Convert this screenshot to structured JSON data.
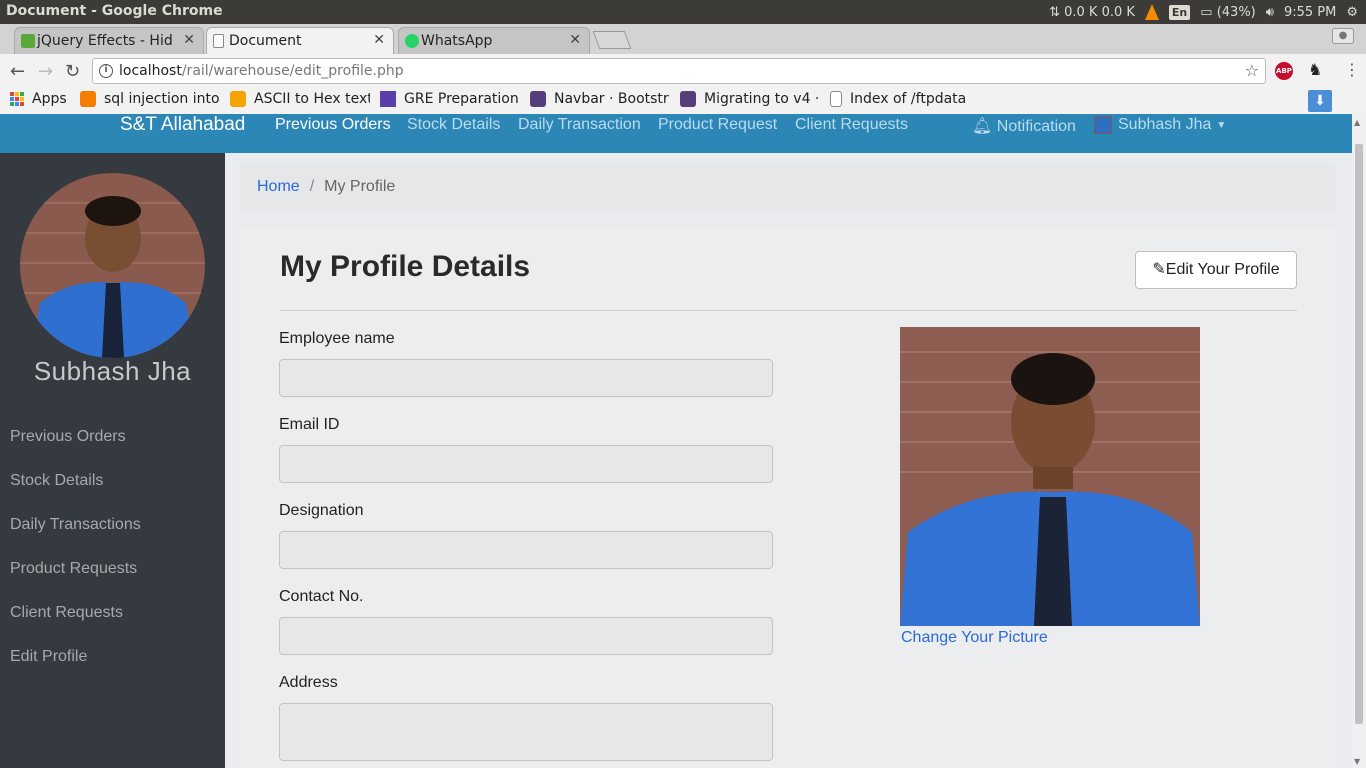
{
  "os": {
    "window_title": "Document - Google Chrome",
    "network": "0.0 K 0.0 K",
    "lang": "En",
    "battery": "(43%)",
    "clock": "9:55 PM"
  },
  "tabs": [
    {
      "label": "jQuery Effects - Hid"
    },
    {
      "label": "Document"
    },
    {
      "label": "WhatsApp"
    }
  ],
  "omnibox": {
    "host": "localhost",
    "path": "/rail/warehouse/edit_profile.php"
  },
  "bookmarks": [
    {
      "label": "Apps"
    },
    {
      "label": "sql injection into"
    },
    {
      "label": "ASCII to Hex text"
    },
    {
      "label": "GRE Preparation"
    },
    {
      "label": "Navbar · Bootstr"
    },
    {
      "label": "Migrating to v4 ·"
    },
    {
      "label": "Index of /ftpdata"
    }
  ],
  "navbar": {
    "brand": "S&T Allahabad",
    "links": [
      "Previous Orders",
      "Stock Details",
      "Daily Transaction",
      "Product Request",
      "Client Requests"
    ],
    "notification": "Notification",
    "user": "Subhash Jha"
  },
  "sidebar": {
    "name": "Subhash Jha",
    "links": [
      "Previous Orders",
      "Stock Details",
      "Daily Transactions",
      "Product Requests",
      "Client Requests",
      "Edit Profile"
    ]
  },
  "breadcrumb": {
    "home": "Home",
    "separator": "/",
    "current": "My Profile"
  },
  "profile": {
    "title": "My Profile Details",
    "edit_button": "Edit Your Profile",
    "fields": {
      "name": {
        "label": "Employee name",
        "value": ""
      },
      "email": {
        "label": "Email ID",
        "value": ""
      },
      "designation": {
        "label": "Designation",
        "value": ""
      },
      "contact": {
        "label": "Contact No.",
        "value": ""
      },
      "address": {
        "label": "Address",
        "value": ""
      }
    },
    "change_picture": "Change Your Picture"
  },
  "colors": {
    "navbar": "#2c86b6",
    "sidebar": "#343a40",
    "link": "#2a6ad8"
  }
}
